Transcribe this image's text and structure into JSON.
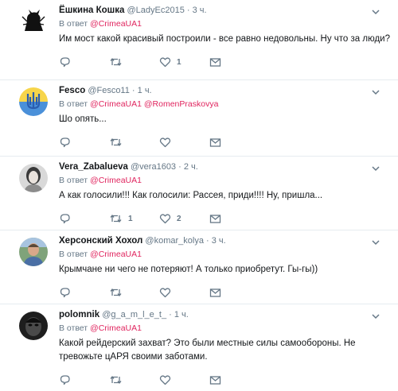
{
  "tweets": [
    {
      "name": "Ёшкина Кошка",
      "handle": "@LadyEc2015",
      "dot": "·",
      "time": "3 ч.",
      "reply_prefix": "В ответ",
      "mentions": [
        "@CrimeaUA1"
      ],
      "text": "Им мост какой красивый построили - все  равно недовольны. Ну что за люди?",
      "counts": {
        "reply": "",
        "retweet": "",
        "like": "1"
      },
      "avatar": "black-cat-avatar"
    },
    {
      "name": "Fesco",
      "handle": "@Fesco11",
      "dot": "·",
      "time": "1 ч.",
      "reply_prefix": "В ответ",
      "mentions": [
        "@CrimeaUA1",
        "@RomenPraskovya"
      ],
      "text": "Шо опять...",
      "counts": {
        "reply": "",
        "retweet": "",
        "like": ""
      },
      "avatar": "trident-avatar"
    },
    {
      "name": "Vera_Zabalueva",
      "handle": "@vera1603",
      "dot": "·",
      "time": "2 ч.",
      "reply_prefix": "В ответ",
      "mentions": [
        "@CrimeaUA1"
      ],
      "text": "А как голосили!!! Как голосили: Рассея, приди!!!! Ну, пришла...",
      "counts": {
        "reply": "",
        "retweet": "1",
        "like": "2"
      },
      "avatar": "portrait-avatar"
    },
    {
      "name": "Херсонский Хохол",
      "handle": "@komar_kolya",
      "dot": "·",
      "time": "3 ч.",
      "reply_prefix": "В ответ",
      "mentions": [
        "@CrimeaUA1"
      ],
      "text": "Крымчане ни чего не потеряют! А только приобретут. Гы-гы))",
      "counts": {
        "reply": "",
        "retweet": "",
        "like": ""
      },
      "avatar": "man-photo-avatar"
    },
    {
      "name": "polomnik",
      "handle": "@g_a_m_l_e_t_",
      "dot": "·",
      "time": "1 ч.",
      "reply_prefix": "В ответ",
      "mentions": [
        "@CrimeaUA1"
      ],
      "text": "Какой рейдерский захват? Это были местные силы самообороны. Не тревожьте цАРЯ своими заботами.",
      "counts": {
        "reply": "",
        "retweet": "",
        "like": ""
      },
      "avatar": "dark-face-avatar"
    }
  ],
  "colors": {
    "mention": "#e0245e",
    "muted": "#657786",
    "border": "#e6ecf0"
  }
}
